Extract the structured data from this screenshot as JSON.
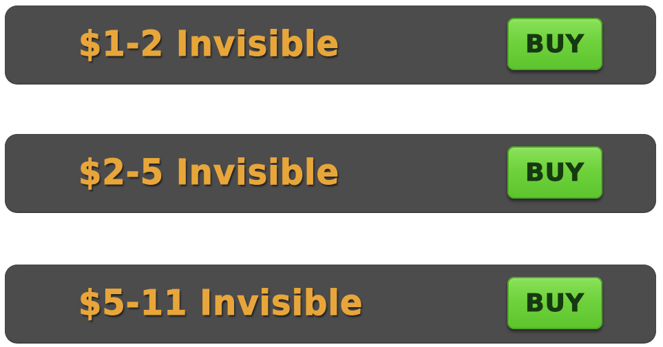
{
  "offers": [
    {
      "title": "$1-2 Invisible",
      "button_label": "BUY"
    },
    {
      "title": "$2-5 Invisible",
      "button_label": "BUY"
    },
    {
      "title": "$5-11 Invisible",
      "button_label": "BUY"
    }
  ],
  "colors": {
    "bar_background": "#4c4c4c",
    "title_text": "#e8a63a",
    "buy_button": "#6fd23d",
    "buy_text": "#163a10"
  }
}
